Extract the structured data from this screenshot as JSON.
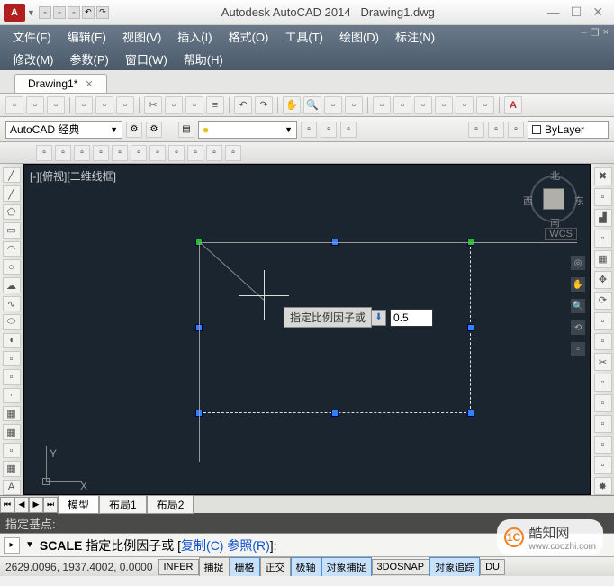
{
  "app": {
    "product": "Autodesk AutoCAD 2014",
    "document": "Drawing1.dwg"
  },
  "menus": {
    "row1": [
      "文件(F)",
      "编辑(E)",
      "视图(V)",
      "插入(I)",
      "格式(O)",
      "工具(T)",
      "绘图(D)",
      "标注(N)"
    ],
    "row2": [
      "修改(M)",
      "参数(P)",
      "窗口(W)",
      "帮助(H)"
    ]
  },
  "tab": {
    "name": "Drawing1*"
  },
  "workspace": {
    "name": "AutoCAD 经典"
  },
  "layer_prop": {
    "bylayer": "ByLayer"
  },
  "viewport": {
    "label": "[-][俯视][二维线框]"
  },
  "viewcube": {
    "n": "北",
    "s": "南",
    "e": "东",
    "w": "西",
    "wcs": "WCS"
  },
  "dynamic_input": {
    "prompt": "指定比例因子或",
    "value": "0.5"
  },
  "ucs": {
    "x": "X",
    "y": "Y"
  },
  "layout_tabs": {
    "model": "模型",
    "l1": "布局1",
    "l2": "布局2"
  },
  "command": {
    "history": "指定基点:",
    "keyword": "SCALE",
    "prompt_a": " 指定比例因子或 [",
    "opt1": "复制(C)",
    "sep": " ",
    "opt2": "参照(R)",
    "prompt_b": "]:"
  },
  "status": {
    "coords": "2629.0096, 1937.4002, 0.0000",
    "btns": [
      "INFER",
      "捕捉",
      "栅格",
      "正交",
      "极轴",
      "对象捕捉",
      "3DOSNAP",
      "对象追踪",
      "DU"
    ]
  },
  "watermark": {
    "icon": "1C",
    "name": "酷知网",
    "url": "www.coozhi.com"
  }
}
